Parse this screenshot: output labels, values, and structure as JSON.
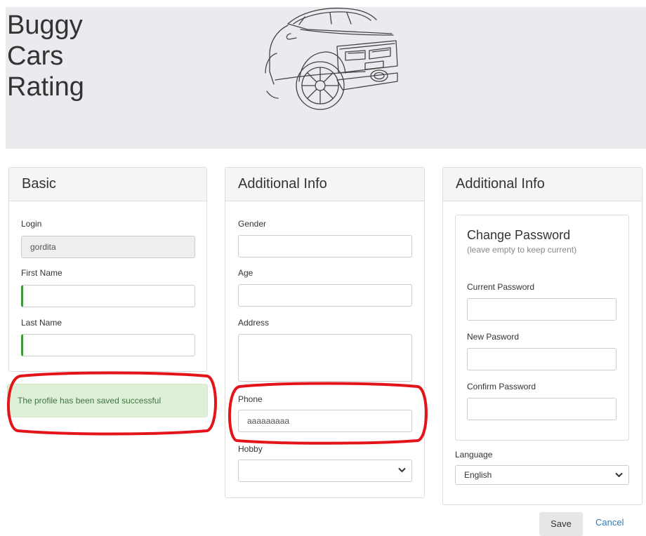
{
  "header": {
    "brand_line1": "Buggy",
    "brand_line2": "Cars",
    "brand_line3": "Rating"
  },
  "basic": {
    "title": "Basic",
    "login_label": "Login",
    "login_value": "gordita",
    "first_name_label": "First Name",
    "first_name_value": "",
    "last_name_label": "Last Name",
    "last_name_value": "",
    "alert": "The profile has been saved successful"
  },
  "additional": {
    "title": "Additional Info",
    "gender_label": "Gender",
    "gender_value": "",
    "age_label": "Age",
    "age_value": "",
    "address_label": "Address",
    "address_value": "",
    "phone_label": "Phone",
    "phone_value": "aaaaaaaaa",
    "hobby_label": "Hobby",
    "hobby_value": ""
  },
  "password_panel": {
    "title": "Additional Info",
    "box_title": "Change Password",
    "box_hint": "(leave empty to keep current)",
    "current_label": "Current Password",
    "new_label": "New Pasword",
    "confirm_label": "Confirm Password",
    "language_label": "Language",
    "language_value": "English"
  },
  "actions": {
    "save": "Save",
    "cancel": "Cancel"
  },
  "icons": {
    "car": "car-illustration-icon",
    "dropdown": "chevron-down-icon"
  },
  "colors": {
    "header_bg": "#e9ebee",
    "success_bg": "#dff0d8",
    "success_text": "#3c763d",
    "valid_border": "#3c9a3c",
    "highlight": "#e3151b",
    "link": "#337ab7"
  }
}
